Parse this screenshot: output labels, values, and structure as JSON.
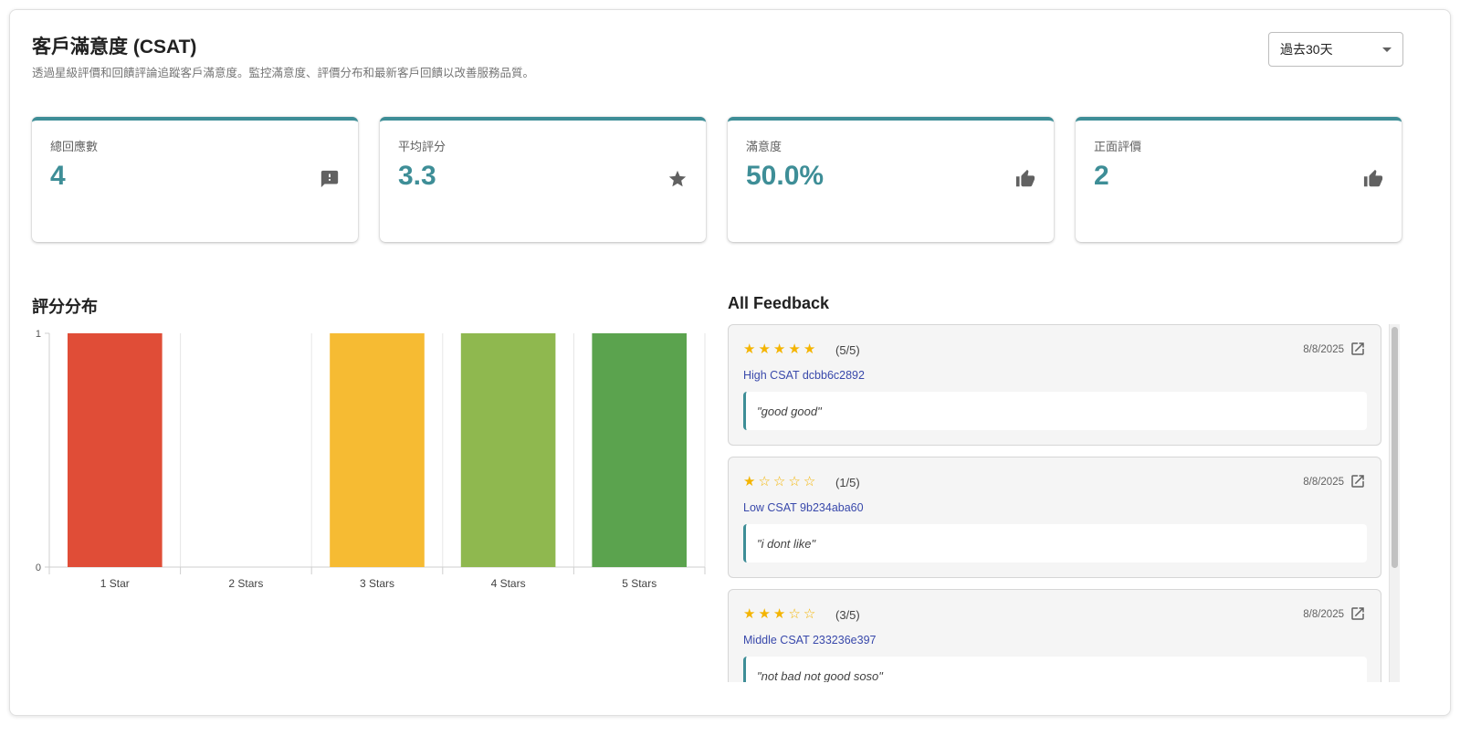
{
  "header": {
    "title": "客戶滿意度 (CSAT)",
    "subtitle": "透過星級評價和回饋評論追蹤客戶滿意度。監控滿意度、評價分布和最新客戶回饋以改善服務品質。",
    "date_range": {
      "selected": "過去30天"
    }
  },
  "kpis": [
    {
      "label": "總回應數",
      "value": "4",
      "icon": "feedback-icon"
    },
    {
      "label": "平均評分",
      "value": "3.3",
      "icon": "star-icon"
    },
    {
      "label": "滿意度",
      "value": "50.0%",
      "icon": "thumb-up-icon"
    },
    {
      "label": "正面評價",
      "value": "2",
      "icon": "thumb-up-icon"
    }
  ],
  "accent_color": "#3e8e97",
  "distribution": {
    "title": "評分分布"
  },
  "chart_data": {
    "type": "bar",
    "categories": [
      "1 Star",
      "2 Stars",
      "3 Stars",
      "4 Stars",
      "5 Stars"
    ],
    "values": [
      1,
      0,
      1,
      1,
      1
    ],
    "colors": [
      "#e04d37",
      "#f29b38",
      "#f6bb33",
      "#8fb84f",
      "#5ba34e"
    ],
    "yticks": [
      0,
      1
    ],
    "ylim": [
      0,
      1
    ],
    "grid": true,
    "legend": "none"
  },
  "feedback": {
    "title": "All Feedback",
    "items": [
      {
        "rating": 5,
        "score": "(5/5)",
        "date": "8/8/2025",
        "name": "High CSAT dcbb6c2892",
        "comment": "\"good good\""
      },
      {
        "rating": 1,
        "score": "(1/5)",
        "date": "8/8/2025",
        "name": "Low CSAT 9b234aba60",
        "comment": "\"i dont like\""
      },
      {
        "rating": 3,
        "score": "(3/5)",
        "date": "8/8/2025",
        "name": "Middle CSAT 233236e397",
        "comment": "\"not bad not good soso\""
      }
    ]
  }
}
